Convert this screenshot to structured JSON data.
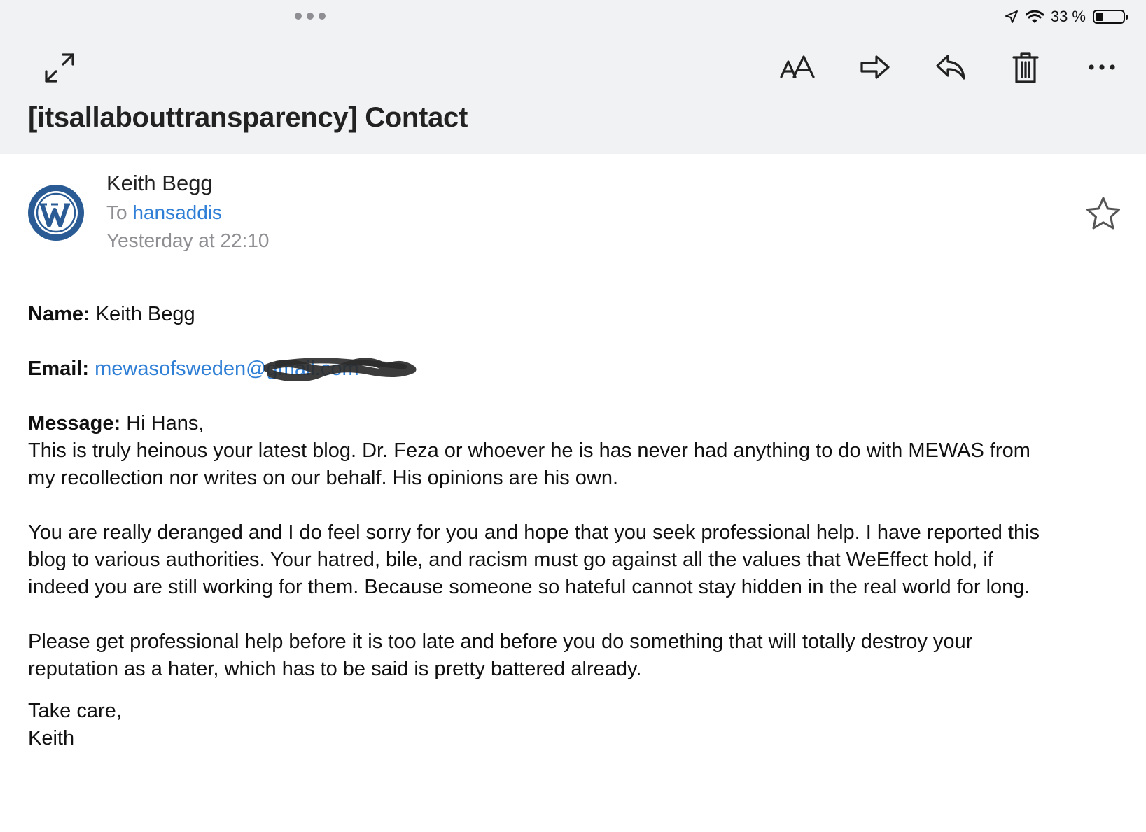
{
  "status_bar": {
    "battery_text": "33 %",
    "icons": [
      "location-arrow-icon",
      "wifi-icon",
      "battery-icon"
    ]
  },
  "toolbar": {
    "icons": [
      "expand-icon",
      "text-size-icon",
      "forward-icon",
      "reply-icon",
      "trash-icon",
      "more-icon"
    ],
    "multitask_dots": "•••"
  },
  "email": {
    "subject": "[itsallabouttransparency] Contact",
    "sender_name": "Keith Begg",
    "to_prefix": "To",
    "recipient": "hansaddis",
    "time": "Yesterday at 22:10",
    "avatar_icon": "wordpress-logo-icon",
    "star_icon": "star-icon"
  },
  "message": {
    "name_label": "Name:",
    "name_value": "Keith Begg",
    "email_label": "Email:",
    "email_value_visible": "mewasofsweden@",
    "email_value_redacted": "gmail.com",
    "message_label": "Message:",
    "greeting": "Hi Hans,",
    "paragraph1_line1": "This is truly heinous your latest blog. Dr. Feza or whoever he is has never had anything to do with MEWAS from",
    "paragraph1_line2": "my recollection nor writes on our behalf. His opinions are his own.",
    "paragraph2_line1": "You are really deranged and I do feel sorry for you and hope that you seek professional help. I have reported this",
    "paragraph2_line2": "blog to various authorities. Your hatred, bile, and racism must go against all the values that WeEffect hold, if",
    "paragraph2_line3": "indeed you are still working for them. Because someone so hateful cannot stay hidden in the real world for long.",
    "paragraph3_line1": "Please get professional help before it is too late and before you do something that will totally destroy your",
    "paragraph3_line2": "reputation as a hater, which has to be said is pretty battered already.",
    "signoff": "Take care,",
    "signature": "Keith"
  },
  "colors": {
    "topbar_bg": "#f1f2f4",
    "link_blue": "#2f7fd6",
    "meta_gray": "#8e8e93",
    "wordpress_blue": "#2a5b94"
  }
}
